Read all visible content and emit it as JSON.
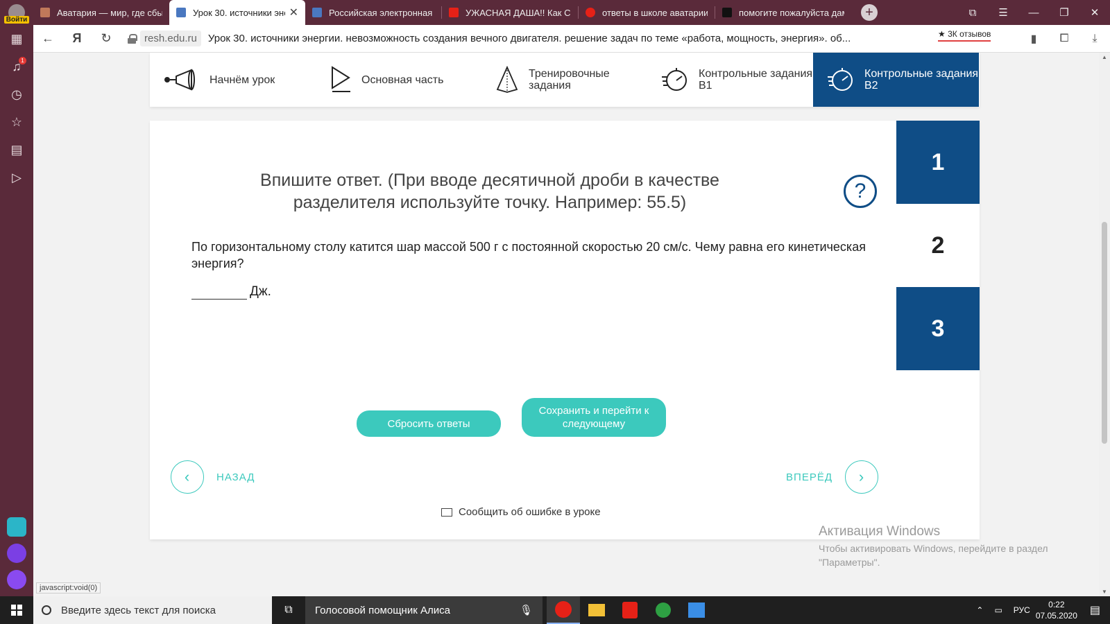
{
  "browser": {
    "profile_login": "Войти",
    "tabs": [
      {
        "label": "Аватария — мир, где сбы",
        "icon": "avatar-favicon",
        "color": "#c0785a"
      },
      {
        "label": "Урок 30. источники эне",
        "icon": "resh-favicon",
        "color": "#4a78c0",
        "active": true
      },
      {
        "label": "Российская электронная ш",
        "icon": "resh-favicon",
        "color": "#4a78c0"
      },
      {
        "label": "УЖАСНАЯ ДАША!! Как Со",
        "icon": "youtube-favicon",
        "color": "#e62117"
      },
      {
        "label": "ответы в школе аватарии",
        "icon": "yandex-favicon",
        "color": "#e62117"
      },
      {
        "label": "помогите пожалуйста дам",
        "icon": "znanija-favicon",
        "color": "#111111"
      }
    ],
    "domain": "resh.edu.ru",
    "page_title": "Урок 30. источники энергии. невозможность создания вечного двигателя. решение задач по теме «работа, мощность, энергия». об...",
    "reviews": "★ 3К отзывов",
    "sidebar_badge": "1",
    "status_url": "javascript:void(0)"
  },
  "lesson_nav": {
    "items": [
      {
        "label": "Начнём урок",
        "icon": "megaphone-icon"
      },
      {
        "label": "Основная часть",
        "icon": "play-icon"
      },
      {
        "label": "Тренировочные задания",
        "icon": "pyramid-icon"
      },
      {
        "label": "Контрольные задания В1",
        "icon": "stopwatch-icon"
      },
      {
        "label": "Контрольные задания В2",
        "icon": "stopwatch-icon",
        "active": true
      }
    ]
  },
  "task": {
    "instruction": "Впишите ответ. (При вводе десятичной дроби в качестве разделителя используйте точку. Например: 55.5)",
    "help_symbol": "?",
    "question": "По горизонтальному столу катится шар массой 500 г с постоянной скоростью 20 см/с. Чему равна его кинетическая энергия?",
    "answer_value": "",
    "answer_unit": "Дж.",
    "question_numbers": [
      "1",
      "2",
      "3"
    ],
    "current_question": "2",
    "reset_label": "Сбросить ответы",
    "save_label": "Сохранить и перейти к следующему",
    "back_label": "НАЗАД",
    "forward_label": "ВПЕРЁД",
    "report_label": "Сообщить об ошибке в уроке"
  },
  "activation": {
    "title": "Активация Windows",
    "text": "Чтобы активировать Windows, перейдите в раздел \"Параметры\"."
  },
  "taskbar": {
    "search_placeholder": "Введите здесь текст для поиска",
    "alice_label": "Голосовой помощник Алиса",
    "lang": "РУС",
    "time": "0:22",
    "date": "07.05.2020"
  },
  "colors": {
    "primary": "#0f4d86",
    "accent": "#3cc9bd",
    "browser_chrome": "#5a2a3a"
  }
}
